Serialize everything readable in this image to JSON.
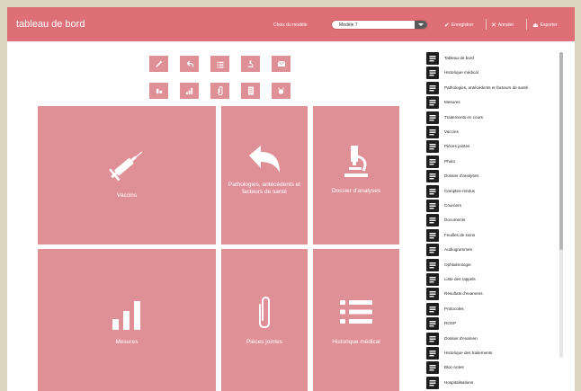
{
  "header": {
    "title": "tableau de bord",
    "model_label": "Choix du modèle",
    "model_value": "Modèle 7",
    "save_label": "Enregistrer",
    "cancel_label": "Annuler",
    "export_label": "Exporter"
  },
  "colors": {
    "topbar": "#df6f77",
    "tile": "#df9096",
    "page_background": "#dcd6bf"
  },
  "quick_buttons": [
    {
      "icon": "syringe-icon"
    },
    {
      "icon": "undo-arrow-icon"
    },
    {
      "icon": "list-icon"
    },
    {
      "icon": "microscope-icon"
    },
    {
      "icon": "mail-icon"
    },
    {
      "icon": "pills-icon"
    },
    {
      "icon": "bar-chart-icon"
    },
    {
      "icon": "paperclip-icon"
    },
    {
      "icon": "document-icon"
    },
    {
      "icon": "alarm-icon"
    }
  ],
  "tiles": [
    {
      "label": "Vaccins",
      "icon": "syringe-icon"
    },
    {
      "label": "Pathologies, antécédents et facteurs de santé",
      "icon": "undo-arrow-icon"
    },
    {
      "label": "Dossier d'analyses",
      "icon": "microscope-icon"
    },
    {
      "label": "Mesures",
      "icon": "bar-chart-icon"
    },
    {
      "label": "Pièces jointes",
      "icon": "paperclip-icon"
    },
    {
      "label": "Historique médical",
      "icon": "list-icon"
    }
  ],
  "sidebar": {
    "items": [
      {
        "label": "Tableau de bord",
        "icon": "dashboard-icon"
      },
      {
        "label": "Historique médical",
        "icon": "list-icon"
      },
      {
        "label": "Pathologies, antécédents et facteurs de santé",
        "icon": "undo-arrow-icon"
      },
      {
        "label": "Mesures",
        "icon": "bar-chart-icon"
      },
      {
        "label": "Traitements en cours",
        "icon": "pills-icon"
      },
      {
        "label": "Vaccins",
        "icon": "syringe-icon"
      },
      {
        "label": "Pièces jointes",
        "icon": "paperclip-icon"
      },
      {
        "label": "Photo",
        "icon": "photo-icon"
      },
      {
        "label": "Dossier d'analyses",
        "icon": "microscope-icon"
      },
      {
        "label": "Comptes-rendus",
        "icon": "document-icon"
      },
      {
        "label": "Courriers",
        "icon": "mail-icon"
      },
      {
        "label": "Documents",
        "icon": "file-icon"
      },
      {
        "label": "Feuilles de soins",
        "icon": "care-sheet-icon"
      },
      {
        "label": "Audiogrammes",
        "icon": "audiogram-icon"
      },
      {
        "label": "Ophtalmologie",
        "icon": "eye-exam-icon"
      },
      {
        "label": "Liste des rappels",
        "icon": "alarm-icon"
      },
      {
        "label": "Résultats d'examens",
        "icon": "results-icon"
      },
      {
        "label": "Protocoles",
        "icon": "protocol-icon"
      },
      {
        "label": "ROSP",
        "icon": "euro-icon"
      },
      {
        "label": "Dossier d'examen",
        "icon": "exam-folder-icon"
      },
      {
        "label": "Historique des traitements",
        "icon": "treatment-history-icon"
      },
      {
        "label": "Bloc-notes",
        "icon": "notepad-icon"
      },
      {
        "label": "Hospitalisations",
        "icon": "hospital-icon"
      }
    ]
  }
}
